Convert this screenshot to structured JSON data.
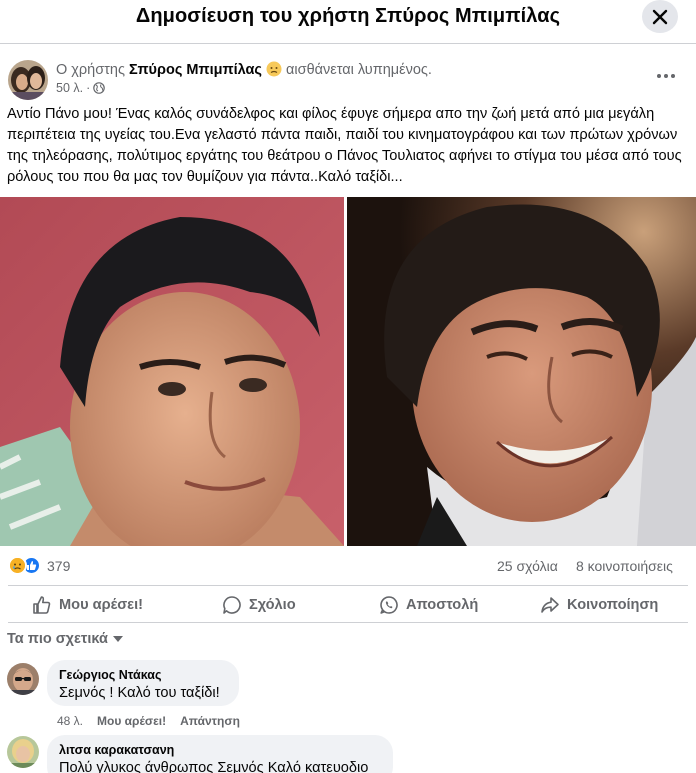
{
  "modal": {
    "title": "Δημοσίευση του χρήστη Σπύρος Μπιμπίλας"
  },
  "post": {
    "prefix": "Ο χρήστης",
    "author": "Σπύρος Μπιμπίλας",
    "feeling": "αισθάνεται λυπημένος.",
    "time": "50 λ.",
    "privacy_icon": "globe-icon",
    "text": "Αντίο Πάνο μου! Ένας καλός συνάδελφος και φίλος έφυγε σήμερα απο την ζωή μετά από μια μεγάλη περιπέτεια της υγείας του.Ενα γελαστό πάντα παιδι, παιδί του κινηματογράφου και των πρώτων χρόνων της τηλεόρασης, πολύτιμος εργάτης του θεάτρου ο Πάνος Τουλιατος αφήνει το στίγμα του μέσα από τους ρόλους του που θα μας τον θυμίζουν για πάντα..Καλό ταξίδι...",
    "reaction_count": "379",
    "comments_count": "25 σχόλια",
    "shares_count": "8 κοινοποιήσεις"
  },
  "actions": {
    "like": "Μου αρέσει!",
    "comment": "Σχόλιο",
    "send": "Αποστολή",
    "share": "Κοινοποίηση"
  },
  "comments_section": {
    "sort_label": "Τα πιο σχετικά"
  },
  "comments": [
    {
      "name": "Γεώργιος Ντάκας",
      "text": "Σεμνός ! Καλό του ταξίδι!",
      "time": "48 λ.",
      "like": "Μου αρέσει!",
      "reply": "Απάντηση"
    },
    {
      "name": "λιτσα καρακατσανη",
      "text": "Πολύ γλυκος άνθρωπος Σεμνός Καλό κατευοδιο"
    }
  ],
  "colors": {
    "brand_blue": "#1877f2",
    "secondary_text": "#65676b",
    "bubble_bg": "#f0f2f5",
    "sad_yellow": "#f7b125"
  }
}
